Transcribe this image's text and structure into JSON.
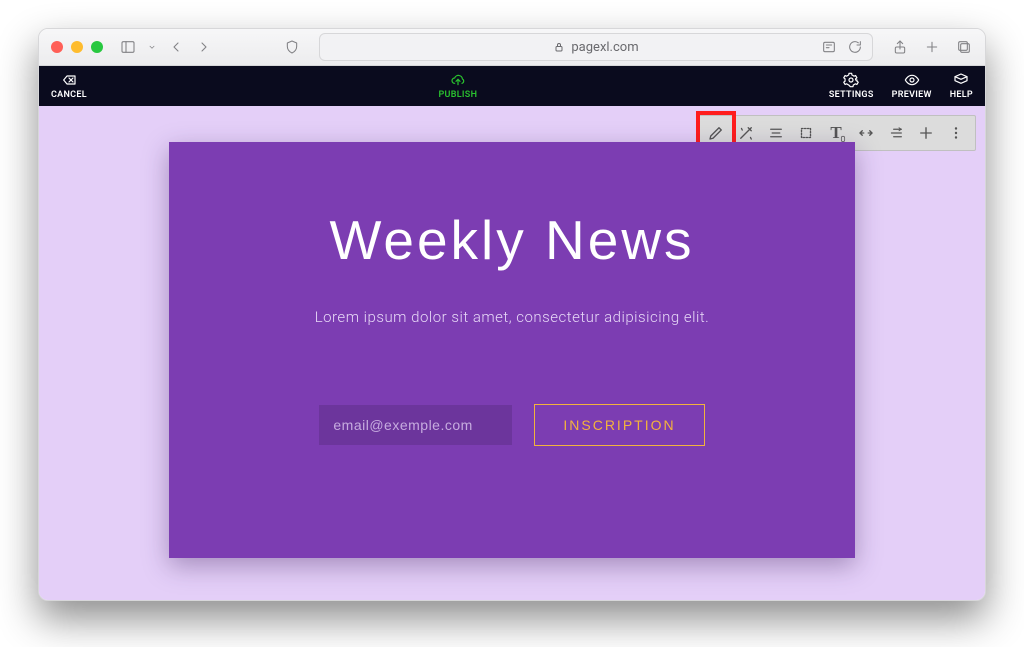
{
  "browser": {
    "domain": "pagexl.com"
  },
  "appbar": {
    "cancel": "CANCEL",
    "publish": "PUBLISH",
    "settings": "SETTINGS",
    "preview": "PREVIEW",
    "help": "HELP"
  },
  "toolbar": {
    "items": [
      "pencil-icon",
      "wand-icon",
      "align-icon",
      "crop-icon",
      "eyedropper-icon",
      "spacing-icon",
      "animate-icon",
      "add-icon",
      "more-icon"
    ],
    "highlighted": "pencil-icon"
  },
  "hero": {
    "title": "Weekly News",
    "subtitle": "Lorem ipsum dolor sit amet, consectetur adipisicing elit.",
    "email_placeholder": "email@exemple.com",
    "button": "INSCRIPTION"
  }
}
